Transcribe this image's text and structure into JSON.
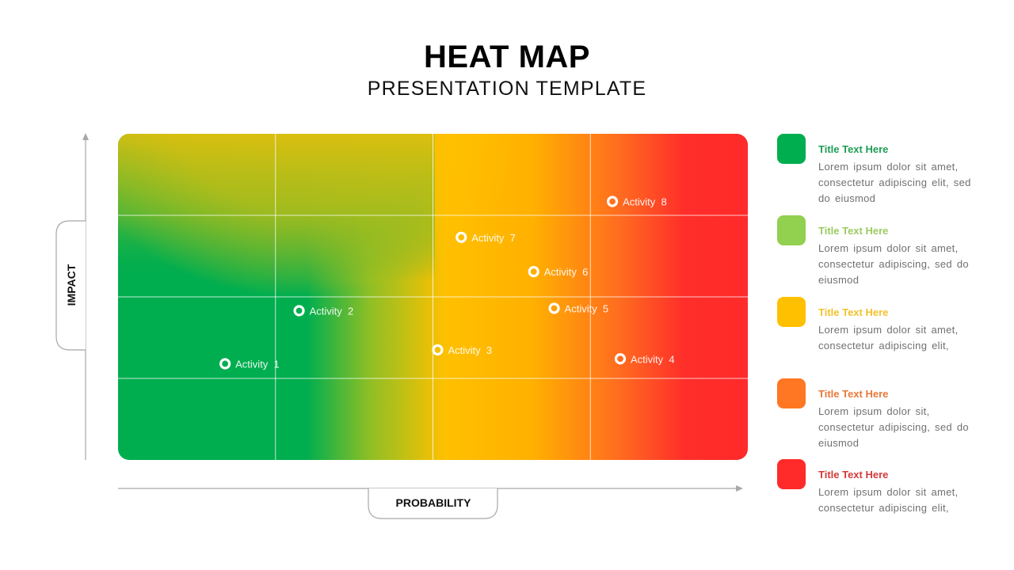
{
  "header": {
    "title": "HEAT MAP",
    "subtitle": "PRESENTATION TEMPLATE"
  },
  "chart_data": {
    "type": "heatmap",
    "title": "HEAT MAP",
    "subtitle": "PRESENTATION TEMPLATE",
    "xlabel": "PROBABILITY",
    "ylabel": "IMPACT",
    "xlim": [
      0,
      4
    ],
    "ylim": [
      0,
      4
    ],
    "grid": true,
    "grid_columns": 4,
    "grid_rows": 4,
    "color_scale": [
      "#00AE4F",
      "#92D050",
      "#FFC000",
      "#FF7722",
      "#FF2A2A"
    ],
    "color_direction": "low (green) bottom-left to high (red) right",
    "points": [
      {
        "label": "Activity  1",
        "x": 0.68,
        "y": 1.18
      },
      {
        "label": "Activity  2",
        "x": 1.15,
        "y": 1.83
      },
      {
        "label": "Activity  3",
        "x": 2.03,
        "y": 1.35
      },
      {
        "label": "Activity  4",
        "x": 3.19,
        "y": 1.24
      },
      {
        "label": "Activity  5",
        "x": 2.77,
        "y": 1.86
      },
      {
        "label": "Activity  6",
        "x": 2.64,
        "y": 2.31
      },
      {
        "label": "Activity  7",
        "x": 2.18,
        "y": 2.73
      },
      {
        "label": "Activity  8",
        "x": 3.14,
        "y": 3.17
      }
    ]
  },
  "legend": {
    "items": [
      {
        "title": "Title Text Here",
        "color": "#00AE4F",
        "title_color": "#1E9E55",
        "description": "Lorem ipsum dolor sit amet, consectetur adipiscing elit, sed do eiusmod"
      },
      {
        "title": "Title Text Here",
        "color": "#92D050",
        "title_color": "#9BCB62",
        "description": "Lorem ipsum dolor sit amet, consectetur adipiscing, sed do eiusmod"
      },
      {
        "title": "Title Text Here",
        "color": "#FFC000",
        "title_color": "#F2C12E",
        "description": "Lorem ipsum dolor sit amet, consectetur adipiscing elit,"
      },
      {
        "title": "Title Text Here",
        "color": "#FF7722",
        "title_color": "#E8793A",
        "description": "Lorem ipsum dolor sit, consectetur adipiscing, sed do eiusmod"
      },
      {
        "title": "Title Text Here",
        "color": "#FF2A2A",
        "title_color": "#D33A3A",
        "description": "Lorem ipsum dolor sit amet, consectetur adipiscing elit,"
      }
    ]
  }
}
